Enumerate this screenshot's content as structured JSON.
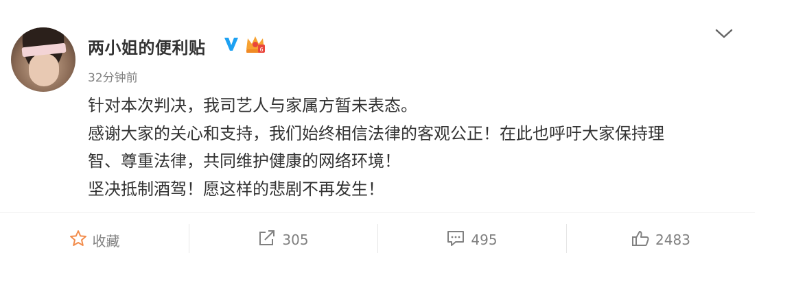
{
  "post": {
    "author": "两小姐的便利贴",
    "time": "32分钟前",
    "lines": [
      "针对本次判决，我司艺人与家属方暂未表态。",
      "感谢大家的关心和支持，我们始终相信法律的客观公正！在此也呼吁大家保持理",
      "智、尊重法律，共同维护健康的网络环境！",
      "坚决抵制酒驾！愿这样的悲剧不再发生！"
    ]
  },
  "actions": {
    "favorite_label": "收藏",
    "repost_count": "305",
    "comment_count": "495",
    "like_count": "2483"
  },
  "icons": {
    "verified": "verified-v-icon",
    "vip": "vip-crown-icon",
    "menu": "chevron-down-icon",
    "favorite": "star-icon",
    "repost": "share-arrow-icon",
    "comment": "comment-bubble-icon",
    "like": "thumbs-up-icon"
  },
  "colors": {
    "verified_blue": "#1da1f2",
    "vip_orange": "#f7a232",
    "favorite_orange": "#f28c4b",
    "text_primary": "#333333",
    "text_secondary": "#808080"
  }
}
